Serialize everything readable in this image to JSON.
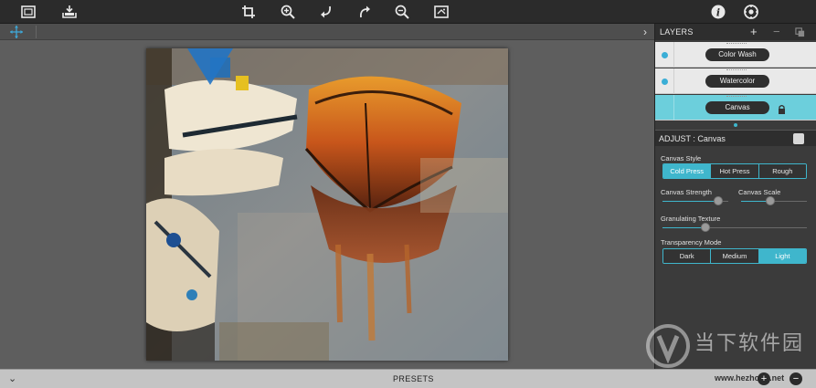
{
  "toolbar": {
    "icons": [
      "gallery-icon",
      "save-icon",
      "crop-icon",
      "zoom-in-icon",
      "undo-icon",
      "redo-icon",
      "zoom-out-icon",
      "fit-icon",
      "info-icon",
      "settings-icon"
    ]
  },
  "panel": {
    "layers_title": "LAYERS",
    "add": "+",
    "remove": "−",
    "layers": [
      {
        "name": "Color Wash",
        "active": false
      },
      {
        "name": "Watercolor",
        "active": false
      },
      {
        "name": "Canvas",
        "active": true,
        "locked": true
      }
    ],
    "adjust_title": "ADJUST : Canvas",
    "canvas_style": {
      "label": "Canvas Style",
      "options": [
        "Cold Press",
        "Hot Press",
        "Rough"
      ],
      "selected": "Cold Press"
    },
    "canvas_strength": {
      "label": "Canvas Strength",
      "value": 0.85
    },
    "canvas_scale": {
      "label": "Canvas Scale",
      "value": 0.45
    },
    "granulating_texture": {
      "label": "Granulating Texture",
      "value": 0.3
    },
    "transparency_mode": {
      "label": "Transparency Mode",
      "options": [
        "Dark",
        "Medium",
        "Light"
      ],
      "selected": "Light"
    }
  },
  "bottombar": {
    "presets_label": "PRESETS",
    "toggle": "⌄",
    "watermark_url": "www.hezhong.net"
  },
  "brand": {
    "text": "当下软件园"
  },
  "colors": {
    "accent": "#3fb6cc",
    "active_layer": "#6ccfdc"
  }
}
